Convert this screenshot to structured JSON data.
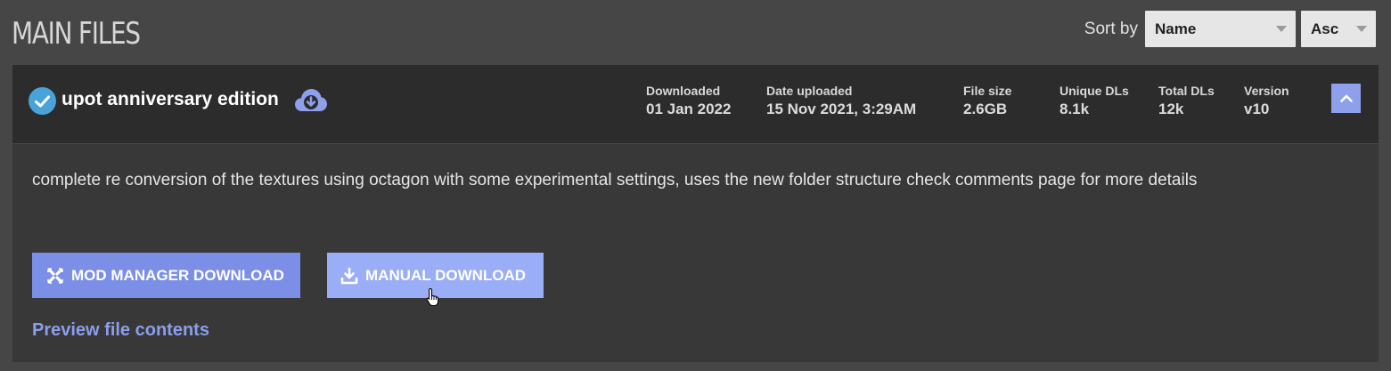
{
  "section": {
    "title": "MAIN FILES"
  },
  "sort": {
    "label": "Sort by",
    "field_value": "Name",
    "order_value": "Asc"
  },
  "file": {
    "name": "upot anniversary edition",
    "stats": [
      {
        "label": "Downloaded",
        "value": "01 Jan 2022"
      },
      {
        "label": "Date uploaded",
        "value": "15 Nov 2021, 3:29AM"
      },
      {
        "label": "File size",
        "value": "2.6GB"
      },
      {
        "label": "Unique DLs",
        "value": "8.1k"
      },
      {
        "label": "Total DLs",
        "value": "12k"
      },
      {
        "label": "Version",
        "value": "v10"
      }
    ],
    "description": "complete re conversion of the textures using octagon with some experimental settings, uses the new folder structure check comments page for more details",
    "buttons": {
      "mod_manager": "MOD MANAGER DOWNLOAD",
      "manual": "MANUAL DOWNLOAD"
    },
    "preview_link": "Preview file contents"
  },
  "icons": {
    "downloaded": "check-circle-icon",
    "cloud": "cloud-download-icon",
    "collapse": "chevron-up-icon",
    "mod_manager": "vortex-icon",
    "manual": "download-tray-icon",
    "cursor": "hand-pointer-icon"
  },
  "colors": {
    "accent": "#7b8fe6",
    "accent_light": "#9aadf7",
    "check": "#4aa3d8"
  }
}
